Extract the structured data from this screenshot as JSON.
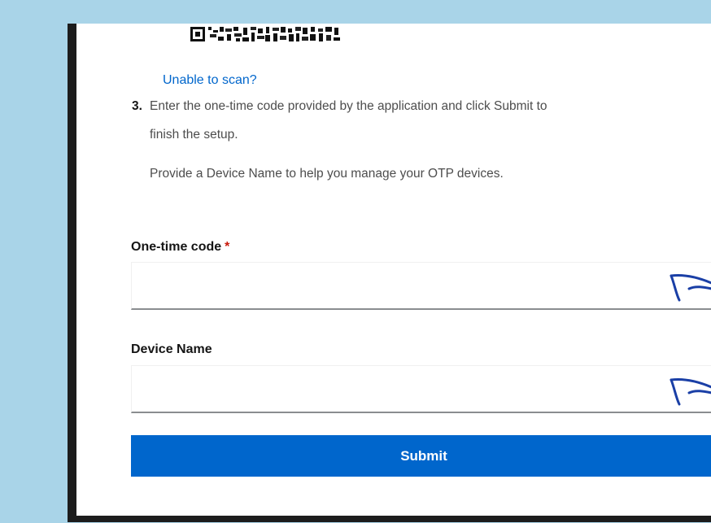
{
  "setup": {
    "scan_link": "Unable to scan?",
    "step_number": "3.",
    "step_line1": "Enter the one-time code provided by the application and click Submit to",
    "step_line2": "finish the setup.",
    "provide_text": "Provide a Device Name to help you manage your OTP devices."
  },
  "form": {
    "otp_label": "One-time code",
    "otp_required_mark": "*",
    "otp_value": "",
    "device_label": "Device Name",
    "device_value": "",
    "submit_label": "Submit"
  },
  "colors": {
    "page_background": "#a9d4e8",
    "link": "#0066cc",
    "primary_button": "#0066cc",
    "required_mark": "#c9190b",
    "annotation_ink": "#1a3fa6"
  },
  "annotations": {
    "otp_field_marker": "hand-drawn-arrow-icon",
    "device_field_marker": "hand-drawn-arrow-icon"
  }
}
